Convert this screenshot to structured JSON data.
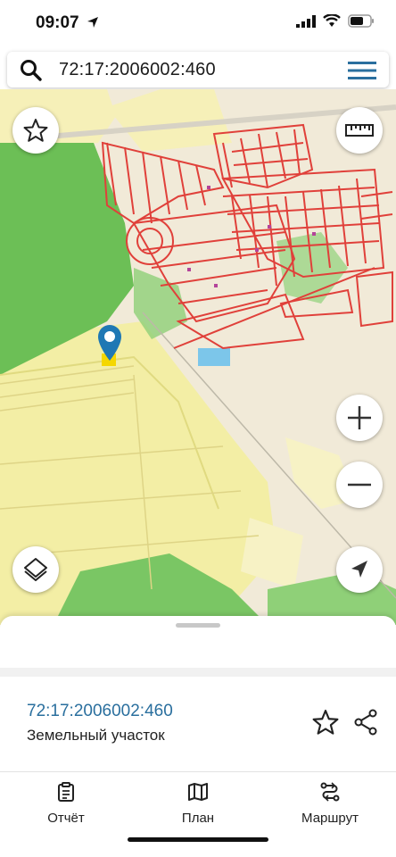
{
  "status_bar": {
    "time": "09:07"
  },
  "search": {
    "value": "72:17:2006002:460"
  },
  "map": {
    "icons": [
      "star-icon",
      "ruler-icon",
      "layers-icon",
      "zoom-in-icon",
      "zoom-out-icon",
      "location-arrow-icon",
      "map-pin-icon"
    ]
  },
  "sheet": {
    "cadastral_number": "72:17:2006002:460",
    "object_type": "Земельный участок"
  },
  "bottom_nav": [
    {
      "label": "Отчёт",
      "icon": "report-icon"
    },
    {
      "label": "План",
      "icon": "map-book-icon"
    },
    {
      "label": "Маршрут",
      "icon": "route-icon"
    }
  ],
  "colors": {
    "accent": "#2a6f9e",
    "parcel_outline": "#e0403a",
    "forest": "#6cbf56",
    "field": "#f2ec9e"
  }
}
